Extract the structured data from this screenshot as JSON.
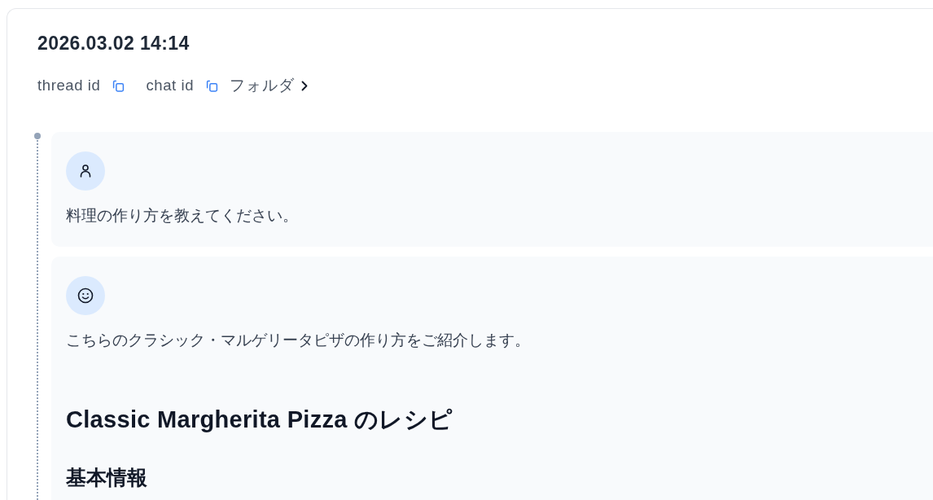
{
  "thread": {
    "timestamp": "2026.03.02 14:14",
    "meta": [
      {
        "kind": "copy",
        "label": "thread id"
      },
      {
        "kind": "copy",
        "label": "chat id"
      },
      {
        "kind": "link",
        "label": "フォルダ"
      }
    ]
  },
  "messages": [
    {
      "kind": "user",
      "blocks": [
        {
          "kind": "paragraph",
          "text": "料理の作り方を教えてください。"
        }
      ]
    },
    {
      "kind": "assistant",
      "blocks": [
        {
          "kind": "paragraph",
          "text": "こちらのクラシック・マルゲリータピザの作り方をご紹介します。"
        },
        {
          "kind": "heading1",
          "text": "Classic Margherita Pizza のレシピ"
        },
        {
          "kind": "heading2",
          "text": "基本情報"
        }
      ]
    }
  ]
}
